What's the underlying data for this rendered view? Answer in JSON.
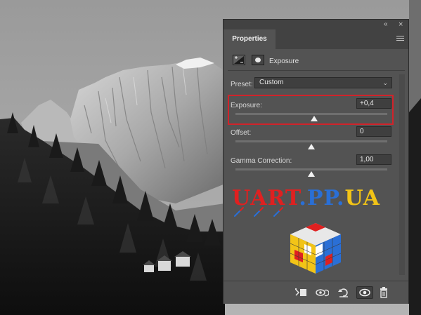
{
  "panel": {
    "tab_label": "Properties",
    "title": "Exposure",
    "collapse_icon": "«",
    "close_icon": "×"
  },
  "preset": {
    "label": "Preset:",
    "value": "Custom"
  },
  "controls": [
    {
      "label": "Exposure:",
      "value": "+0,4"
    },
    {
      "label": "Offset:",
      "value": "0"
    },
    {
      "label": "Gamma Correction:",
      "value": "1,00"
    }
  ],
  "watermark": {
    "text": "UART.PP.UA",
    "colors": [
      "#e02020",
      "#2a6fd6",
      "#f2c417"
    ]
  },
  "colors": {
    "highlight": "#d1232a",
    "panel_bg": "#535353"
  }
}
